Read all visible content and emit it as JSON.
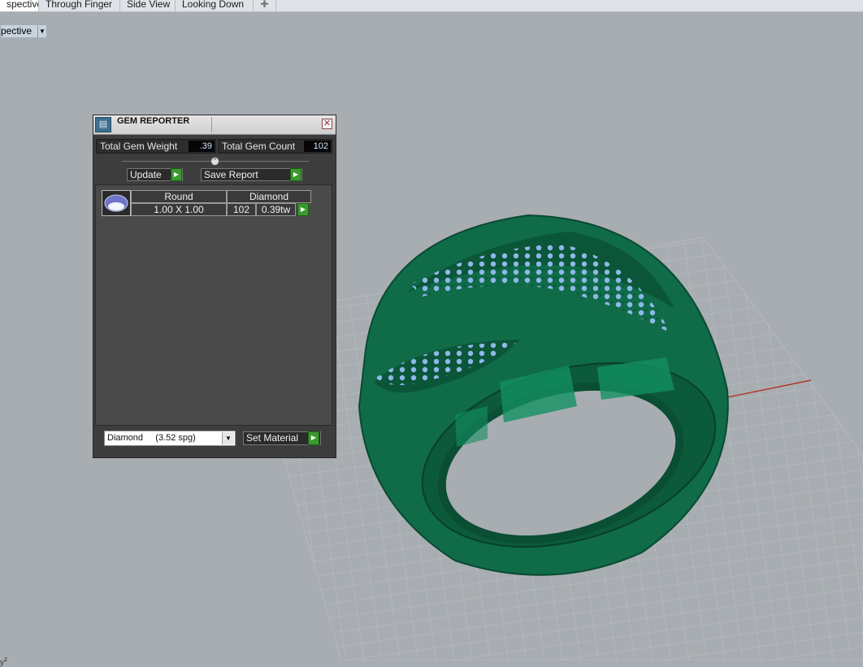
{
  "tabs": [
    {
      "label": "spective",
      "active": true
    },
    {
      "label": "Through Finger",
      "active": false
    },
    {
      "label": "Side View",
      "active": false
    },
    {
      "label": "Looking Down",
      "active": false
    }
  ],
  "tab_add_icon": "plus-icon",
  "viewport": {
    "label": "pective",
    "axis_label_z": "z",
    "axis_label_y": "y",
    "ring_color": "#0f6b48",
    "gem_color": "#8fb8e8"
  },
  "gem_reporter": {
    "title": "GEM REPORTER",
    "total_weight_label": "Total Gem Weight",
    "total_weight_value": ".39",
    "total_count_label": "Total Gem Count",
    "total_count_value": "102",
    "update_label": "Update",
    "save_report_label": "Save Report",
    "gems": [
      {
        "shape": "Round",
        "material": "Diamond",
        "size": "1.00 X 1.00",
        "count": "102",
        "weight": "0.39tw"
      }
    ],
    "material_select": "Diamond     (3.52 spg)",
    "set_material_label": "Set Material"
  }
}
